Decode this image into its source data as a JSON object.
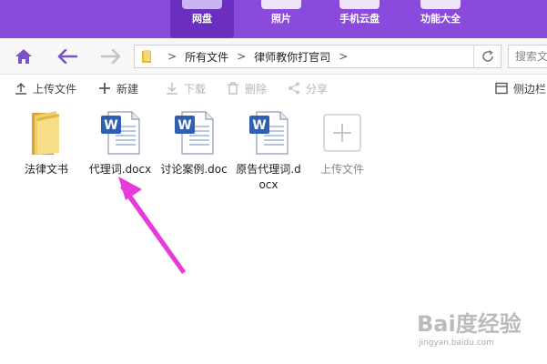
{
  "top_nav": {
    "items": [
      {
        "label": "网盘",
        "active": true
      },
      {
        "label": "照片",
        "active": false
      },
      {
        "label": "手机云盘",
        "active": false
      },
      {
        "label": "功能大全",
        "active": false
      }
    ]
  },
  "address": {
    "breadcrumbs": [
      "所有文件",
      "律师教你打官司"
    ],
    "search_placeholder": "搜索文件"
  },
  "toolbar": {
    "upload_label": "上传文件",
    "new_label": "新建",
    "download_label": "下载",
    "delete_label": "删除",
    "share_label": "分享",
    "sidebar_label": "侧边栏"
  },
  "files": [
    {
      "name": "法律文书",
      "type": "folder"
    },
    {
      "name": "代理词.docx",
      "type": "word"
    },
    {
      "name": "讨论案例.doc",
      "type": "word"
    },
    {
      "name": "原告代理词.docx",
      "type": "word"
    }
  ],
  "upload_tile": {
    "label": "上传文件"
  },
  "watermark": {
    "main": "Bai度经验",
    "sub": "jingyan.baidu.com"
  },
  "colors": {
    "brand_purple": "#8a4bdc",
    "active_nav": "#6b2fbf",
    "arrow_magenta": "#e63ad9",
    "home_icon": "#7b52c8",
    "word_blue": "#2f5fae"
  }
}
